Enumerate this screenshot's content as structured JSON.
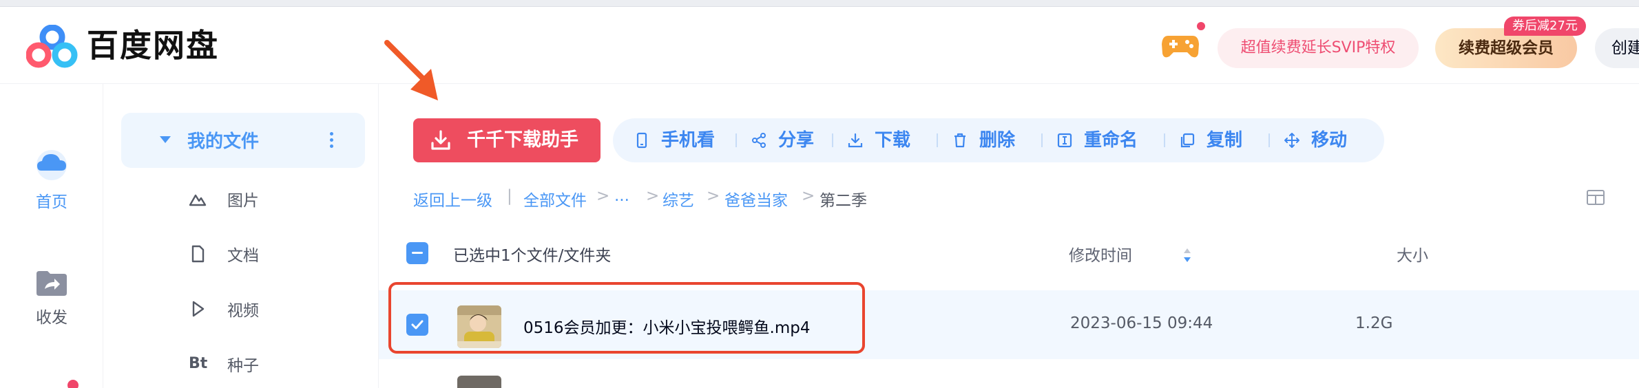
{
  "header": {
    "brand": "百度网盘",
    "svip_promo": "超值续费延长SVIP特权",
    "renew_button": "续费超级会员",
    "coupon_badge": "券后减27元",
    "create_button": "创建"
  },
  "rail": {
    "items": [
      {
        "label": "首页",
        "icon": "cloud-icon",
        "active": true
      },
      {
        "label": "收发",
        "icon": "folder-share-icon",
        "active": false
      }
    ]
  },
  "sidebar": {
    "active": "我的文件",
    "items": [
      {
        "label": "图片",
        "icon": "mountain-icon"
      },
      {
        "label": "文档",
        "icon": "document-icon"
      },
      {
        "label": "视频",
        "icon": "play-icon"
      },
      {
        "label": "种子",
        "icon": "bt-icon",
        "glyph": "Bt"
      }
    ]
  },
  "toolbar": {
    "download_helper": "千千下载助手",
    "actions": [
      {
        "label": "手机看",
        "icon": "phone-icon"
      },
      {
        "label": "分享",
        "icon": "share-icon"
      },
      {
        "label": "下载",
        "icon": "download-icon"
      },
      {
        "label": "删除",
        "icon": "trash-icon"
      },
      {
        "label": "重命名",
        "icon": "rename-icon"
      },
      {
        "label": "复制",
        "icon": "copy-icon"
      },
      {
        "label": "移动",
        "icon": "move-icon"
      }
    ]
  },
  "breadcrumb": {
    "back": "返回上一级",
    "sep": "|",
    "path": [
      "全部文件",
      "...",
      "综艺",
      "爸爸当家"
    ],
    "arrow": ">",
    "current": "第二季"
  },
  "table": {
    "selection_text": "已选中1个文件/文件夹",
    "col_modified": "修改时间",
    "col_size": "大小",
    "rows": [
      {
        "name": "0516会员加更：小米小宝投喂鳄鱼.mp4",
        "modified": "2023-06-15 09:44",
        "size": "1.2G",
        "selected": true
      }
    ]
  },
  "colors": {
    "accent": "#4a97f5",
    "danger": "#ee4d5f",
    "highlight": "#e9452f"
  }
}
